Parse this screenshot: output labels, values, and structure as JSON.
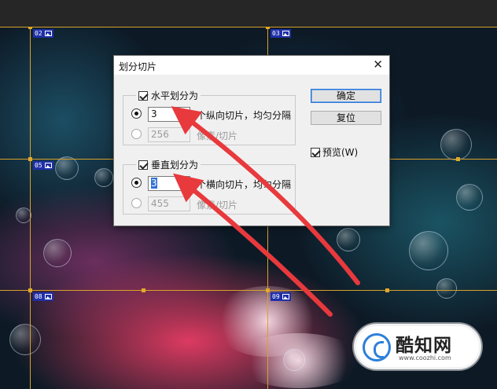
{
  "dialog": {
    "title": "划分切片",
    "close_label": "✕",
    "horizontal": {
      "checkbox_label": "水平划分为",
      "count_value": "3",
      "count_suffix": "个纵向切片，均匀分隔",
      "pixel_value": "256",
      "pixel_suffix": "像素/切片"
    },
    "vertical": {
      "checkbox_label": "垂直划分为",
      "count_value": "3",
      "count_suffix": "个横向切片，均匀分隔",
      "pixel_value": "455",
      "pixel_suffix": "像素/切片"
    },
    "ok_label": "确定",
    "reset_label": "复位",
    "preview_label": "预览(W)"
  },
  "slices": [
    "02",
    "03",
    "05",
    "06",
    "08",
    "09"
  ],
  "watermark": {
    "name": "酷知网",
    "url": "www.coozhi.com"
  },
  "colors": {
    "guide": "#d9a12a",
    "slice_tag": "#1f2fa8",
    "arrow": "#e8393d",
    "default_button_border": "#2b74d6"
  }
}
